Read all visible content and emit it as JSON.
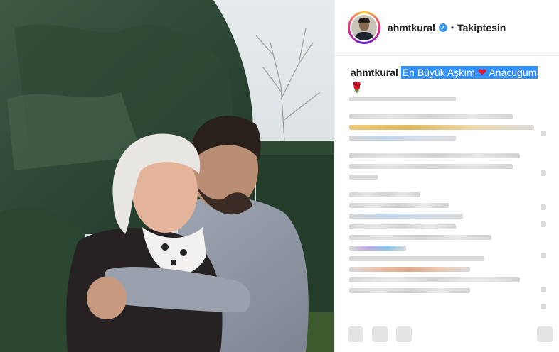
{
  "post": {
    "username": "ahmtkural",
    "verified_mark": "✓",
    "separator": "•",
    "follow_label": "Takiptesin"
  },
  "caption": {
    "username": "ahmtkural",
    "text_before": "En Büyük Aşkım",
    "heart": "❤",
    "text_after": "Anacuğum",
    "rose": "🌹"
  },
  "colors": {
    "verified": "#3897f0",
    "selection": "#3390ff",
    "heart": "#e0182d"
  },
  "icons": {
    "verified": "verified-badge-icon",
    "heart": "heart-emoji-icon",
    "rose": "rose-emoji-icon"
  }
}
